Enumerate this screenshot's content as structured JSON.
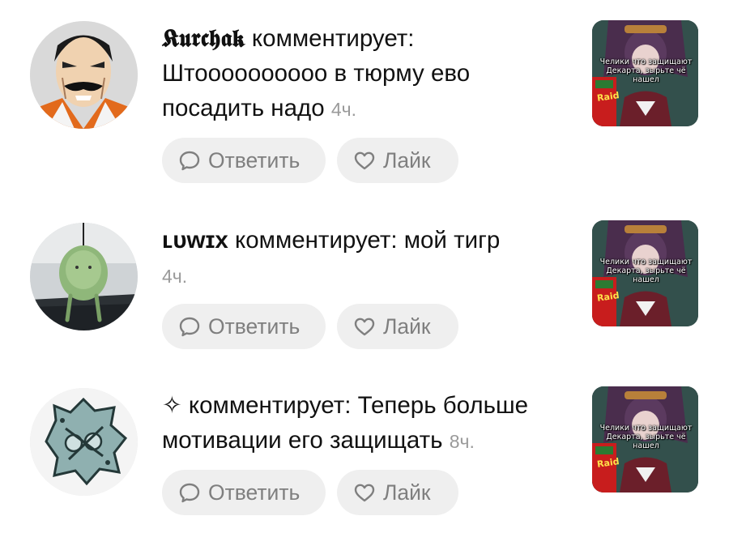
{
  "comments": [
    {
      "username": "𝕶𝖚𝖗𝖈𝖍𝖆𝖐",
      "text": " комментирует: Штоооооооооо в тюрму ево посадить надо",
      "time": "4ч.",
      "reply_label": "Ответить",
      "like_label": "Лайк",
      "thumbnail": {
        "caption": "Челики что защищают Декарта, зырьте чё нашел",
        "brand": "Raid"
      },
      "avatar": "comic-villain-avatar"
    },
    {
      "username": "ʟᴜᴡɪx",
      "text": " комментирует: мой тигр",
      "time": "4ч.",
      "reply_label": "Ответить",
      "like_label": "Лайк",
      "thumbnail": {
        "caption": "Челики что защищают Декарта, зырьте чё нашел",
        "brand": "Raid"
      },
      "avatar": "green-toy-avatar"
    },
    {
      "username": "✧",
      "text": " комментирует: Теперь больше мотивации его защищать",
      "time": "8ч.",
      "reply_label": "Ответить",
      "like_label": "Лайк",
      "thumbnail": {
        "caption": "Челики что защищают Декарта, зырьте чё нашел",
        "brand": "Raid"
      },
      "avatar": "sticker-avatar"
    }
  ],
  "colors": {
    "pill_bg": "#efefef",
    "pill_text": "#7f7f7f",
    "time": "#9a9a9a"
  }
}
